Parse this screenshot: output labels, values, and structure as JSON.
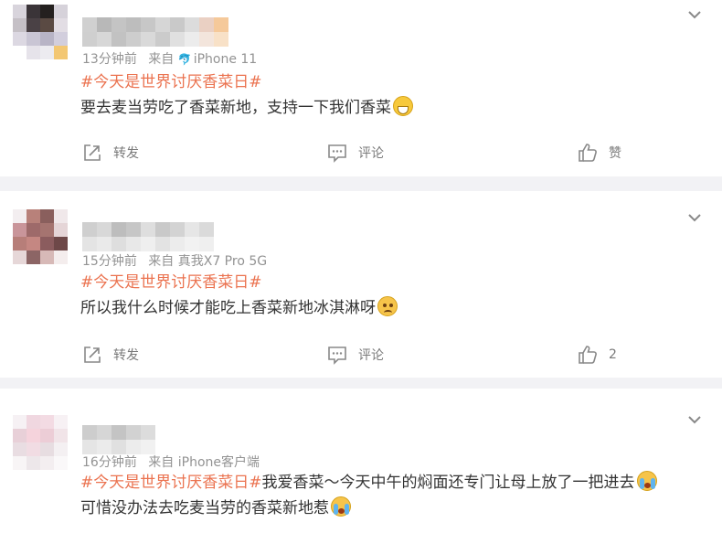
{
  "posts": [
    {
      "time": "13分钟前",
      "source_prefix": "来自",
      "source": "iPhone 11",
      "topic": "#今天是世界讨厌香菜日#",
      "text": "要去麦当劳吃了香菜新地，支持一下我们香菜",
      "emoji": "grin-icon",
      "forward_label": "转发",
      "comment_label": "评论",
      "like_label": "赞"
    },
    {
      "time": "15分钟前",
      "source_prefix": "来自",
      "source": "真我X7 Pro 5G",
      "topic": "#今天是世界讨厌香菜日#",
      "text": "所以我什么时候才能吃上香菜新地冰淇淋呀",
      "emoji": "pleading-icon",
      "forward_label": "转发",
      "comment_label": "评论",
      "like_label": "2"
    },
    {
      "time": "16分钟前",
      "source_prefix": "来自",
      "source": "iPhone客户端",
      "topic": "#今天是世界讨厌香菜日#",
      "text_a": "我爱香菜～今天中午的焖面还专门让母上放了一把进去",
      "text_b": "可惜没办法去吃麦当劳的香菜新地惹"
    }
  ],
  "colors": {
    "topic": "#eb7350",
    "meta": "#939393",
    "background": "#f2f2f5"
  }
}
